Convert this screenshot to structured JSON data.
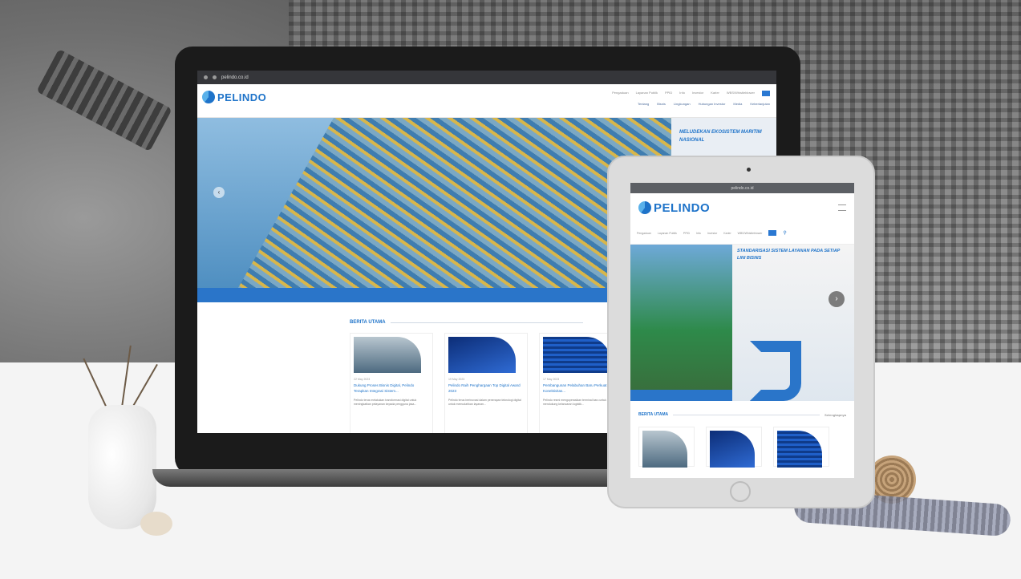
{
  "laptop": {
    "url": "pelindo.co.id",
    "logo_text": "PELINDO",
    "topnav": [
      "Pengaduan",
      "Layanan Publik",
      "PPID",
      "Info",
      "Investor",
      "Karier",
      "WBS/Whistleblower"
    ],
    "subnav": [
      "Tentang",
      "Bisnis",
      "Lingkungan",
      "Hubungan Investor",
      "Media",
      "Keberlanjutan"
    ],
    "hero_side_text": "MELUDEKAN EKOSISTEM MARITIM NASIONAL",
    "hero_prev": "‹",
    "news_title": "BERITA UTAMA",
    "cards": [
      {
        "date": "22 May 2023",
        "title": "Dukung Proses Bisnis Digital, Pelindo Terapkan Integrasi Sistem...",
        "text": "Pelindo terus melakukan transformasi digital untuk meningkatkan pelayanan kepada pengguna jasa..."
      },
      {
        "date": "19 May 2023",
        "title": "Pelindo Raih Penghargaan Top Digital Award 2023",
        "text": "Pelindo terus berinovasi dalam penerapan teknologi digital untuk memudahkan layanan..."
      },
      {
        "date": "17 May 2023",
        "title": "Pembangunan Pelabuhan Baru Perkuat Konektivitas...",
        "text": "Pelindo resmi mengoperasikan terminal baru untuk mendukung kelancaran logistik..."
      }
    ]
  },
  "tablet": {
    "url": "pelindo.co.id",
    "logo_text": "PELINDO",
    "nav": [
      "Pengaduan",
      "Layanan Publik",
      "PPID",
      "Info",
      "Investor",
      "Karier",
      "WBS/Whistleblower"
    ],
    "hero_text": "STANDARISASI SISTEM LAYANAN PADA SETIAP LINI BISNIS",
    "hero_next": "›",
    "news_title": "BERITA UTAMA",
    "news_more": "Selengkapnya"
  }
}
